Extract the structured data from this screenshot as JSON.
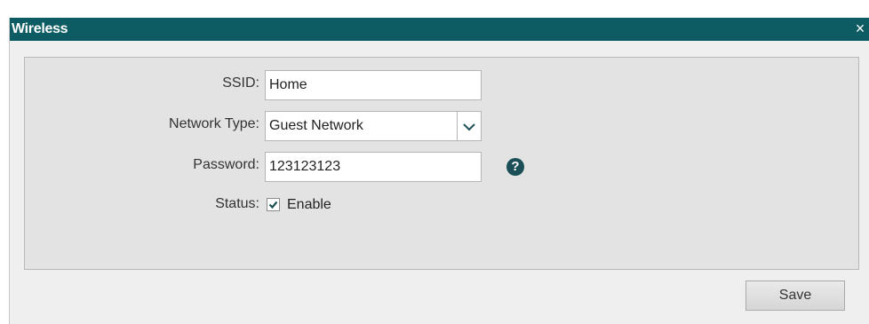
{
  "window": {
    "title": "Wireless",
    "close_symbol": "×"
  },
  "form": {
    "ssid": {
      "label": "SSID:",
      "value": "Home"
    },
    "network_type": {
      "label": "Network Type:",
      "selected": "Guest Network"
    },
    "password": {
      "label": "Password:",
      "value": "123123123"
    },
    "status": {
      "label": "Status:",
      "checkbox_label": "Enable",
      "checked": true
    },
    "help_symbol": "?"
  },
  "actions": {
    "save_label": "Save"
  },
  "colors": {
    "titlebar": "#0d5c63",
    "panel": "#e3e3e3",
    "help_icon": "#1b4f55",
    "check_mark": "#1b4f55"
  },
  "icons": {
    "close": "close-icon",
    "dropdown": "chevron-down-icon",
    "help": "question-mark-icon",
    "checkbox": "checkmark-icon"
  }
}
